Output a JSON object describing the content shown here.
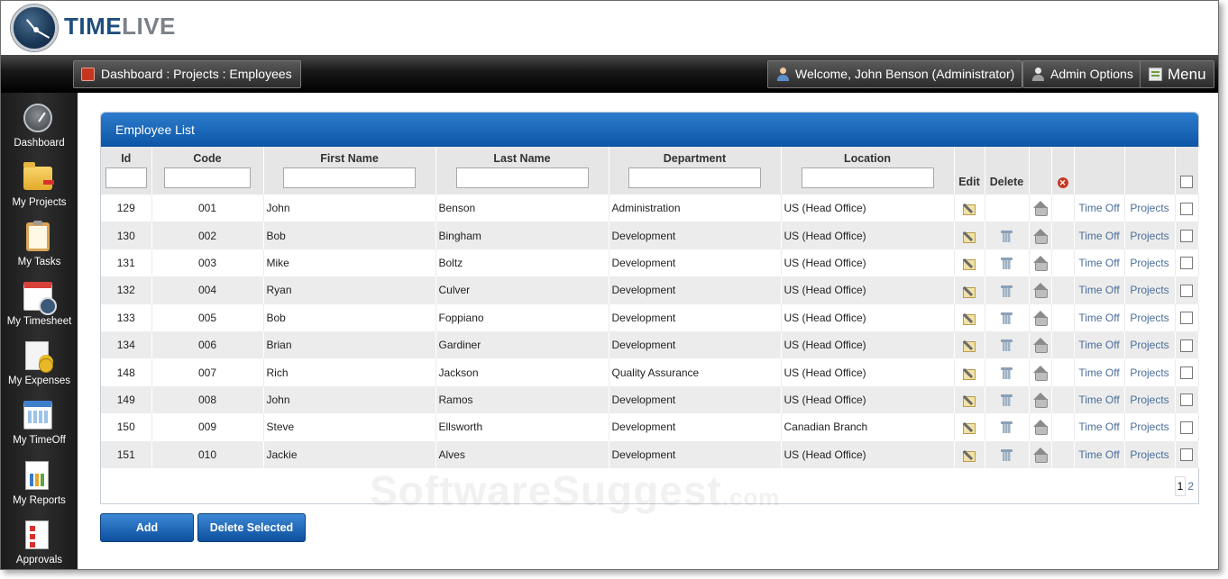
{
  "header": {
    "logo_part1": "TIME",
    "logo_part2": "LIVE"
  },
  "topbar": {
    "breadcrumb": "Dashboard : Projects : Employees",
    "welcome": "Welcome, John Benson (Administrator)",
    "admin_options": "Admin Options",
    "menu": "Menu"
  },
  "sidebar": {
    "items": [
      {
        "label": "Dashboard",
        "icon": "dashboard-icon"
      },
      {
        "label": "My Projects",
        "icon": "folder-icon"
      },
      {
        "label": "My Tasks",
        "icon": "clipboard-icon"
      },
      {
        "label": "My Timesheet",
        "icon": "calendar-clock-icon"
      },
      {
        "label": "My Expenses",
        "icon": "expenses-icon"
      },
      {
        "label": "My TimeOff",
        "icon": "calendar-icon"
      },
      {
        "label": "My Reports",
        "icon": "report-chart-icon"
      },
      {
        "label": "Approvals",
        "icon": "checklist-icon"
      }
    ]
  },
  "panel": {
    "title": "Employee List",
    "columns": {
      "id": "Id",
      "code": "Code",
      "first_name": "First Name",
      "last_name": "Last Name",
      "department": "Department",
      "location": "Location",
      "edit": "Edit",
      "delete": "Delete"
    },
    "rows": [
      {
        "id": "129",
        "code": "001",
        "first": "John",
        "last": "Benson",
        "dept": "Administration",
        "loc": "US (Head Office)",
        "deletable": false
      },
      {
        "id": "130",
        "code": "002",
        "first": "Bob",
        "last": "Bingham",
        "dept": "Development",
        "loc": "US (Head Office)",
        "deletable": true
      },
      {
        "id": "131",
        "code": "003",
        "first": "Mike",
        "last": "Boltz",
        "dept": "Development",
        "loc": "US (Head Office)",
        "deletable": true
      },
      {
        "id": "132",
        "code": "004",
        "first": "Ryan",
        "last": "Culver",
        "dept": "Development",
        "loc": "US (Head Office)",
        "deletable": true
      },
      {
        "id": "133",
        "code": "005",
        "first": "Bob",
        "last": "Foppiano",
        "dept": "Development",
        "loc": "US (Head Office)",
        "deletable": true
      },
      {
        "id": "134",
        "code": "006",
        "first": "Brian",
        "last": "Gardiner",
        "dept": "Development",
        "loc": "US (Head Office)",
        "deletable": true
      },
      {
        "id": "148",
        "code": "007",
        "first": "Rich",
        "last": "Jackson",
        "dept": "Quality Assurance",
        "loc": "US (Head Office)",
        "deletable": true
      },
      {
        "id": "149",
        "code": "008",
        "first": "John",
        "last": "Ramos",
        "dept": "Development",
        "loc": "US (Head Office)",
        "deletable": true
      },
      {
        "id": "150",
        "code": "009",
        "first": "Steve",
        "last": "Ellsworth",
        "dept": "Development",
        "loc": "Canadian Branch",
        "deletable": true
      },
      {
        "id": "151",
        "code": "010",
        "first": "Jackie",
        "last": "Alves",
        "dept": "Development",
        "loc": "US (Head Office)",
        "deletable": true
      }
    ],
    "time_off_label": "Time Off",
    "projects_label": "Projects",
    "pages": [
      "1",
      "2"
    ],
    "current_page": "1"
  },
  "buttons": {
    "add": "Add",
    "delete_selected": "Delete Selected"
  },
  "watermark": {
    "main": "SoftwareSuggest",
    "suffix": ".com"
  },
  "colors": {
    "panel_header": "#1a66b8",
    "link": "#4a6e99",
    "topbar": "#1a1a1a"
  }
}
